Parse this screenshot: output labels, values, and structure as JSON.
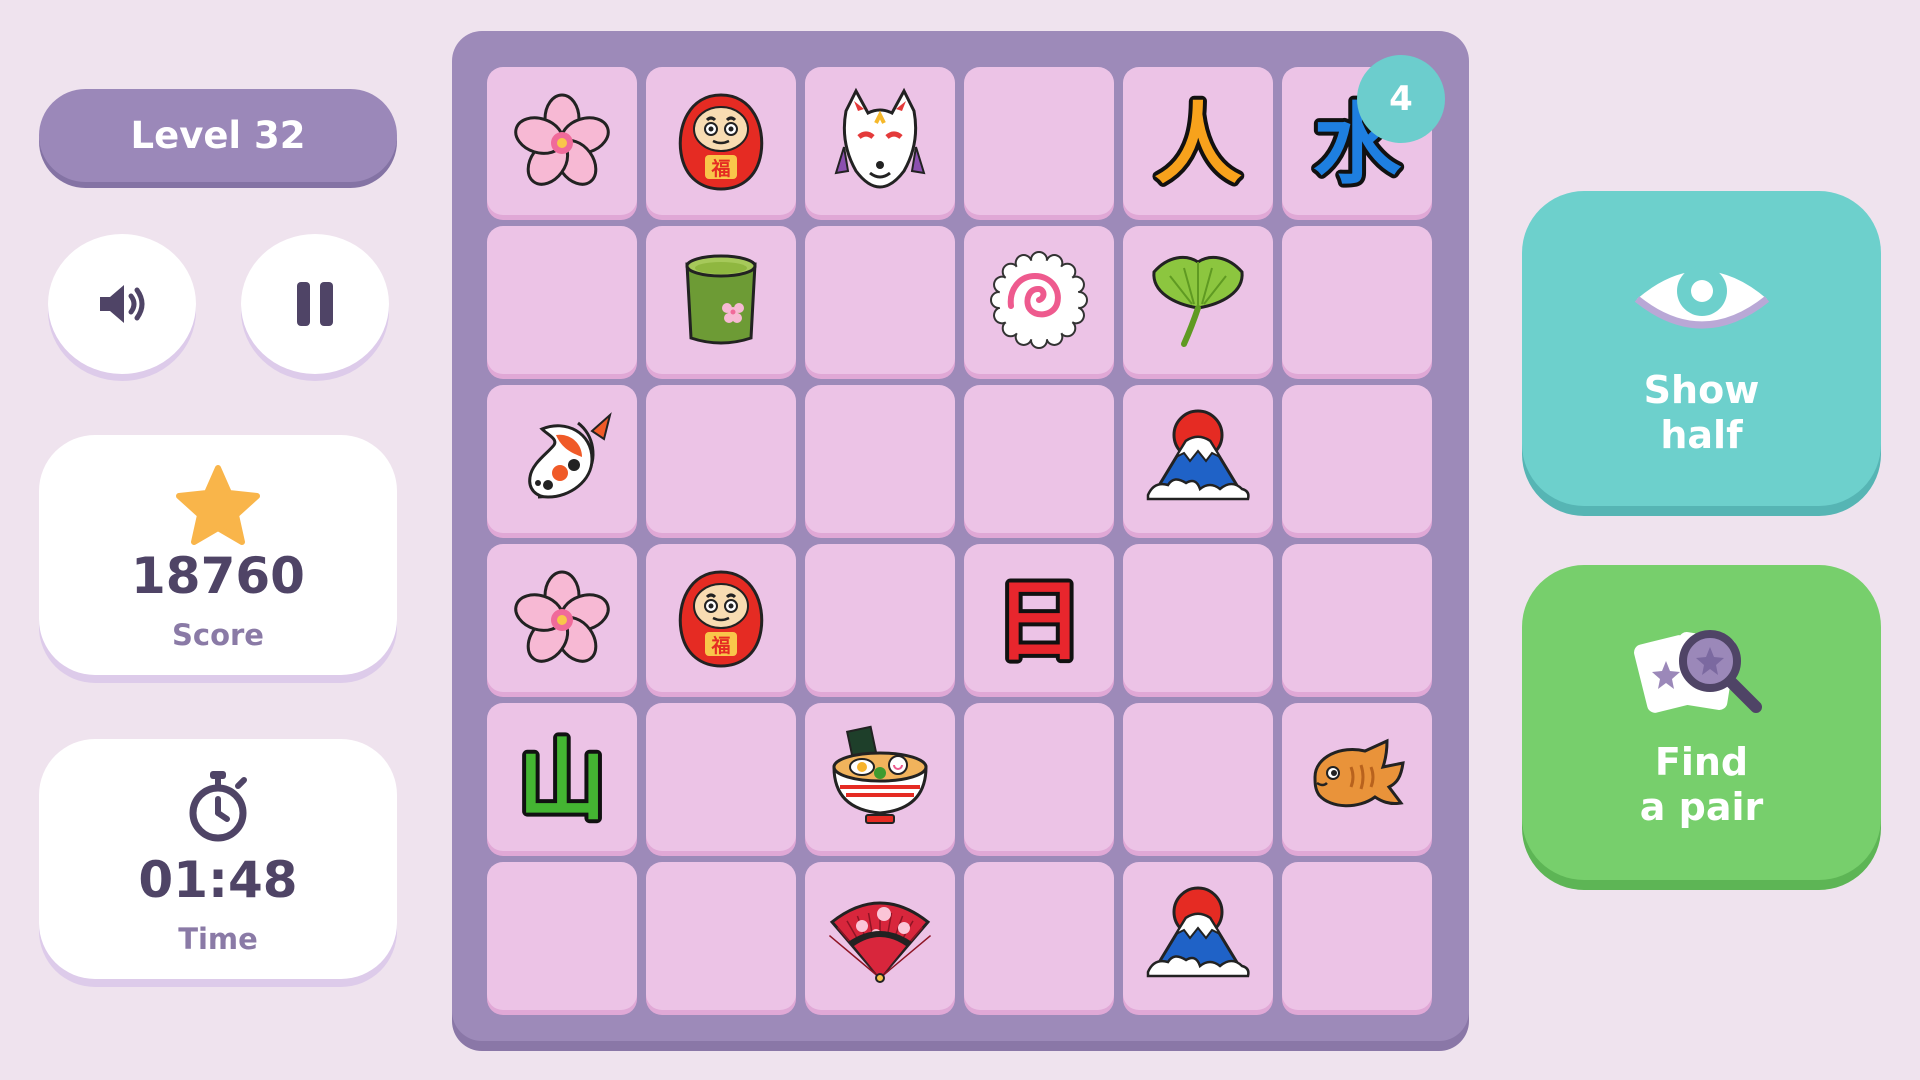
{
  "header": {
    "level_label": "Level 32"
  },
  "controls": {
    "sound_icon": "speaker-icon",
    "pause_icon": "pause-icon"
  },
  "stats": {
    "score": {
      "value": "18760",
      "label": "Score",
      "icon": "star-icon"
    },
    "time": {
      "value": "01:48",
      "label": "Time",
      "icon": "stopwatch-icon"
    }
  },
  "board": {
    "badge_count": "4",
    "rows": [
      [
        "sakura",
        "daruma",
        "kitsune-mask",
        "",
        "kanji-person",
        "kanji-water"
      ],
      [
        "",
        "matcha-cup",
        "",
        "narutomaki",
        "ginkgo-leaf",
        ""
      ],
      [
        "koi-fish",
        "",
        "",
        "",
        "mount-fuji",
        ""
      ],
      [
        "sakura",
        "daruma",
        "",
        "kanji-sun",
        "",
        ""
      ],
      [
        "kanji-mountain",
        "",
        "ramen-bowl",
        "",
        "",
        "taiyaki"
      ],
      [
        "",
        "",
        "folding-fan",
        "",
        "mount-fuji",
        ""
      ]
    ],
    "kanji": {
      "kanji-person": "人",
      "kanji-water": "水",
      "kanji-sun": "日",
      "kanji-mountain": "山"
    },
    "colors": {
      "kanji-person": "#f7a21c",
      "kanji-water": "#1e7fe0",
      "kanji-sun": "#e8262d",
      "kanji-mountain": "#44b532"
    }
  },
  "powerups": {
    "show_half": {
      "line1": "Show",
      "line2": "half",
      "icon": "eye-icon"
    },
    "find_pair": {
      "line1": "Find",
      "line2": "a pair",
      "icon": "magnifier-cards-icon"
    }
  },
  "theme": {
    "background": "#efe3ee",
    "board": "#9d8ab9",
    "tile": "#ecc3e6",
    "teal": "#6dd0cc",
    "green": "#77cf6c",
    "purple": "#9b88b9"
  }
}
